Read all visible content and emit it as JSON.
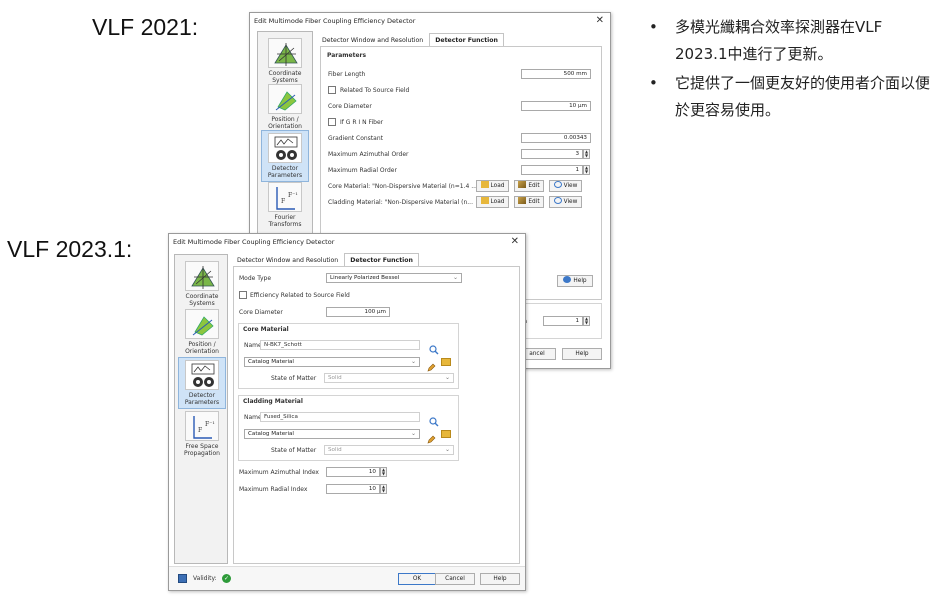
{
  "labels": {
    "old": "VLF 2021:",
    "new": "VLF 2023.1:"
  },
  "bullets": [
    {
      "dot": "•",
      "text": "多模光纖耦合效率探測器在VLF 2023.1中進行了更新。"
    },
    {
      "dot": "•",
      "text": "它提供了一個更友好的使用者介面以便於更容易使用。"
    }
  ],
  "old_dialog": {
    "title": "Edit Multimode Fiber Coupling Efficiency Detector",
    "close": "✕",
    "nav": [
      "Coordinate Systems",
      "Position / Orientation",
      "Detector Parameters",
      "Fourier Transforms"
    ],
    "tabs": [
      "Detector Window and Resolution",
      "Detector Function"
    ],
    "group_title": "Parameters",
    "fiber_length_label": "Fiber Length",
    "fiber_length_value": "500 mm",
    "related_label": "Related To Source Field",
    "core_diameter_label": "Core Diameter",
    "core_diameter_value": "10 µm",
    "grin_label": "If G R I N Fiber",
    "gradient_label": "Gradient Constant",
    "gradient_value": "0.00343",
    "max_az_label": "Maximum Azimuthal Order",
    "max_az_value": "3",
    "max_rad_label": "Maximum Radial Order",
    "max_rad_value": "1",
    "core_mat_label": "Core Material: \"Non-Dispersive Material (n=1.4 ...",
    "clad_mat_label": "Cladding Material: \"Non-Dispersive Material (n...",
    "load": "Load",
    "edit": "Edit",
    "view": "View",
    "help": "Help",
    "partial_ta": "ta",
    "partial_value": "1",
    "cancel_partial": "ancel",
    "help_btn": "Help"
  },
  "new_dialog": {
    "title": "Edit Multimode Fiber Coupling Efficiency Detector",
    "close": "✕",
    "nav": [
      "Coordinate Systems",
      "Position / Orientation",
      "Detector Parameters",
      "Free Space Propagation"
    ],
    "tabs": [
      "Detector Window and Resolution",
      "Detector Function"
    ],
    "mode_type_label": "Mode Type",
    "mode_type_value": "Linearly Polarized Bessel",
    "efficiency_label": "Efficiency Related to Source Field",
    "core_diameter_label": "Core Diameter",
    "core_diameter_value": "100 µm",
    "core_material_title": "Core Material",
    "name_label": "Name",
    "core_name_value": "N-BK7_Schott",
    "catalog_material": "Catalog Material",
    "state_label": "State of Matter",
    "state_value": "Solid",
    "cladding_material_title": "Cladding Material",
    "clad_name_value": "Fused_Silica",
    "max_az_label": "Maximum Azimuthal Index",
    "max_az_value": "10",
    "max_rad_label": "Maximum Radial Index",
    "max_rad_value": "10",
    "validity_label": "Validity:",
    "ok": "OK",
    "cancel": "Cancel",
    "help": "Help"
  },
  "colors": {
    "accent": "#3c78c8",
    "selected_nav": "#cfe3f7",
    "validity_ok": "#2e9b3a",
    "folder": "#e7b73b"
  }
}
